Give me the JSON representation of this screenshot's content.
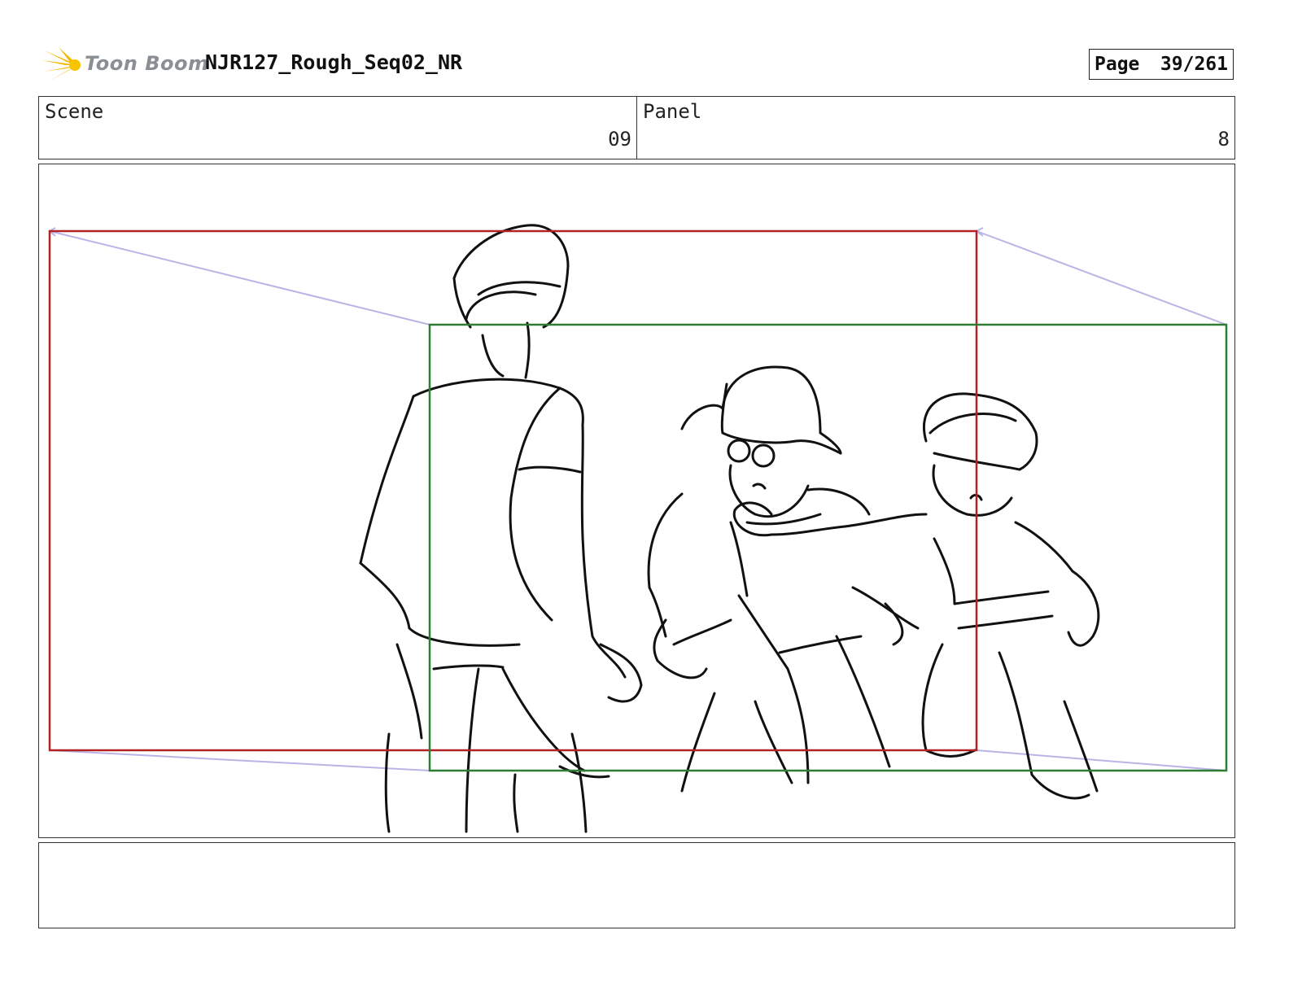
{
  "header": {
    "logo_text": "Toon Boom",
    "title": "NJR127_Rough_Seq02_NR",
    "page_label": "Page",
    "page_number": "39/261"
  },
  "info": {
    "scene_label": "Scene",
    "scene_value": "09",
    "panel_label": "Panel",
    "panel_value": "8"
  },
  "panel": {
    "frame_colors": {
      "start_frame": "#b22222",
      "end_frame": "#2e7d32",
      "camera_path": "#b9b4e6"
    }
  },
  "caption": {
    "text": ""
  }
}
